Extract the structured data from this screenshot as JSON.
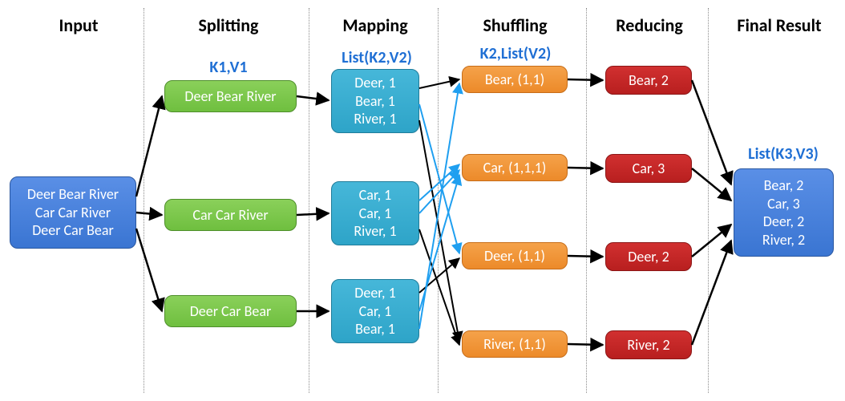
{
  "chart_data": {
    "type": "flow",
    "stages": [
      "Input",
      "Splitting",
      "Mapping",
      "Shuffling",
      "Reducing",
      "Final Result"
    ],
    "input": [
      "Deer Bear River",
      "Car Car River",
      "Deer Car Bear"
    ],
    "splitting": {
      "label": "K1,V1",
      "items": [
        "Deer Bear River",
        "Car Car River",
        "Deer Car Bear"
      ]
    },
    "mapping": {
      "label": "List(K2,V2)",
      "groups": [
        [
          "Deer, 1",
          "Bear, 1",
          "River, 1"
        ],
        [
          "Car, 1",
          "Car, 1",
          "River, 1"
        ],
        [
          "Deer, 1",
          "Car, 1",
          "Bear, 1"
        ]
      ]
    },
    "shuffling": {
      "label": "K2,List(V2)",
      "items": [
        "Bear, (1,1)",
        "Car, (1,1,1)",
        "Deer, (1,1)",
        "River, (1,1)"
      ]
    },
    "reducing": {
      "items": [
        "Bear, 2",
        "Car, 3",
        "Deer, 2",
        "River, 2"
      ]
    },
    "final": {
      "label": "List(K3,V3)",
      "items": [
        "Bear, 2",
        "Car, 3",
        "Deer, 2",
        "River, 2"
      ]
    }
  },
  "headers": {
    "input": "Input",
    "splitting": "Splitting",
    "mapping": "Mapping",
    "shuffling": "Shuffling",
    "reducing": "Reducing",
    "final": "Final Result"
  },
  "sub": {
    "k1v1": "K1,V1",
    "listk2v2": "List(K2,V2)",
    "k2listv2": "K2,List(V2)",
    "listk3v3": "List(K3,V3)"
  },
  "input_lines": {
    "l0": "Deer Bear River",
    "l1": "Car Car River",
    "l2": "Deer Car Bear"
  },
  "split": {
    "s0": "Deer Bear River",
    "s1": "Car Car River",
    "s2": "Deer Car Bear"
  },
  "map0": {
    "l0": "Deer, 1",
    "l1": "Bear, 1",
    "l2": "River, 1"
  },
  "map1": {
    "l0": "Car, 1",
    "l1": "Car, 1",
    "l2": "River, 1"
  },
  "map2": {
    "l0": "Deer, 1",
    "l1": "Car, 1",
    "l2": "Bear, 1"
  },
  "shuf": {
    "s0": "Bear, (1,1)",
    "s1": "Car, (1,1,1)",
    "s2": "Deer, (1,1)",
    "s3": "River, (1,1)"
  },
  "redu": {
    "r0": "Bear, 2",
    "r1": "Car, 3",
    "r2": "Deer, 2",
    "r3": "River, 2"
  },
  "out": {
    "l0": "Bear, 2",
    "l1": "Car, 3",
    "l2": "Deer, 2",
    "l3": "River, 2"
  },
  "colors": {
    "blue": "#3a75d2",
    "green": "#6fbf3f",
    "teal": "#2ea4c8",
    "orange": "#ec8a2a",
    "red": "#b81f1f",
    "arrow_black": "#000",
    "arrow_blue": "#1f9ff0"
  }
}
